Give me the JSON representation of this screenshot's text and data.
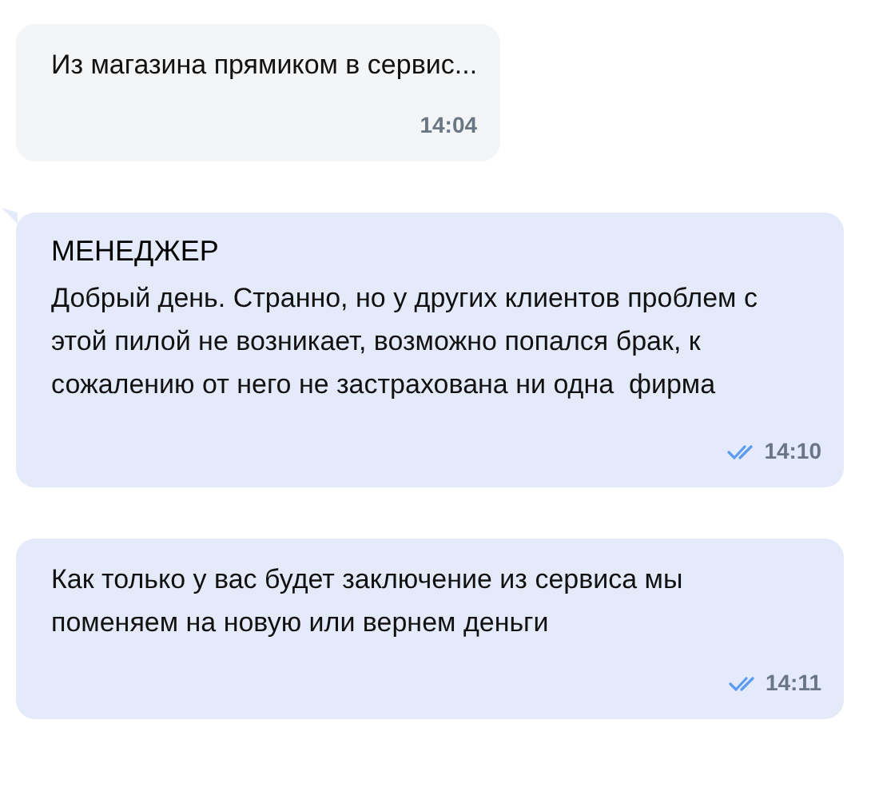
{
  "messages": [
    {
      "kind": "incoming",
      "text": "Из магазина прямиком в сервис...",
      "time": "14:04",
      "read": false
    },
    {
      "kind": "outgoing",
      "sender": "МЕНЕДЖЕР",
      "text": "Добрый день. Странно, но у других клиентов проблем с этой пилой не возникает, возможно попался брак, к сожалению от него не застрахована ни одна  фирма",
      "time": "14:10",
      "read": true
    },
    {
      "kind": "outgoing",
      "text": "Как только у вас будет заключение из сервиса мы поменяем на новую или вернем деньги",
      "time": "14:11",
      "read": true
    }
  ]
}
